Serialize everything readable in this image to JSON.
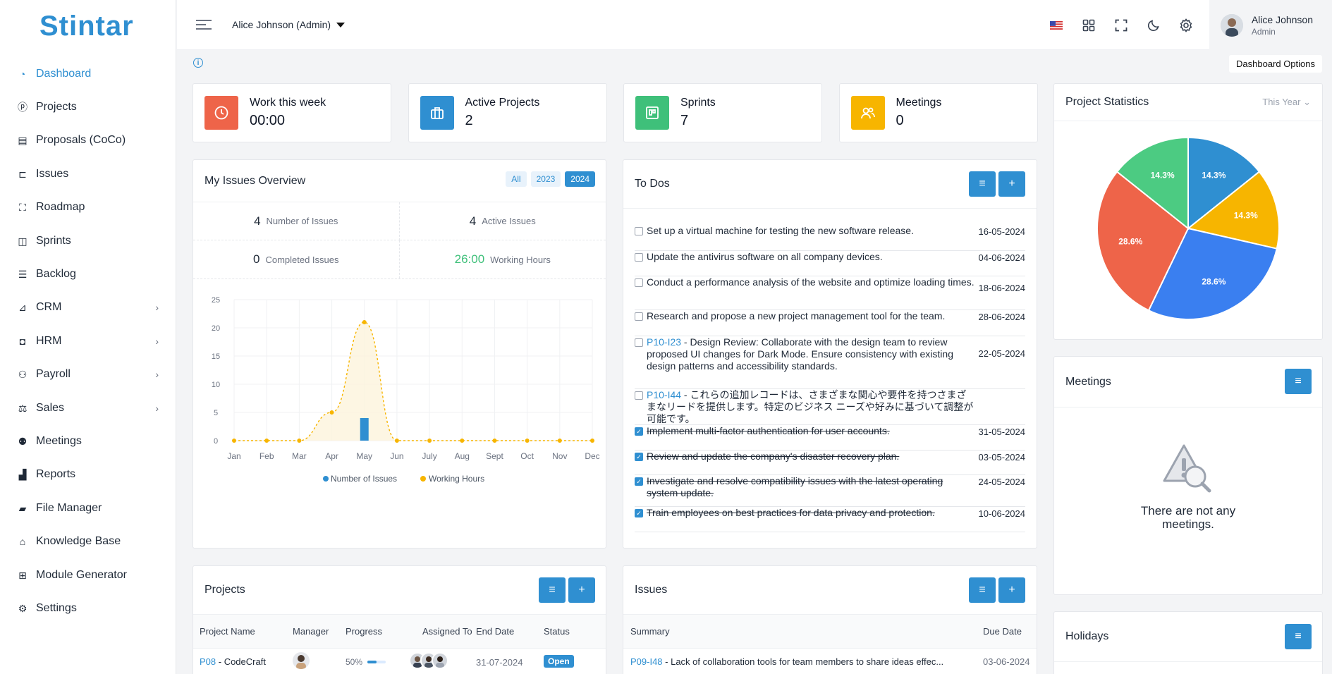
{
  "app": {
    "logo_text": "Stintar"
  },
  "sidebar": {
    "items": [
      {
        "label": "Dashboard",
        "icon": "dashboard-icon"
      },
      {
        "label": "Projects",
        "icon": "projects-icon"
      },
      {
        "label": "Proposals (CoCo)",
        "icon": "proposals-icon"
      },
      {
        "label": "Issues",
        "icon": "issues-icon"
      },
      {
        "label": "Roadmap",
        "icon": "roadmap-icon"
      },
      {
        "label": "Sprints",
        "icon": "sprints-icon"
      },
      {
        "label": "Backlog",
        "icon": "backlog-icon"
      },
      {
        "label": "CRM",
        "icon": "crm-icon"
      },
      {
        "label": "HRM",
        "icon": "hrm-icon"
      },
      {
        "label": "Payroll",
        "icon": "payroll-icon"
      },
      {
        "label": "Sales",
        "icon": "sales-icon"
      },
      {
        "label": "Meetings",
        "icon": "meetings-icon"
      },
      {
        "label": "Reports",
        "icon": "reports-icon"
      },
      {
        "label": "File Manager",
        "icon": "folder-icon"
      },
      {
        "label": "Knowledge Base",
        "icon": "graduation-cap-icon"
      },
      {
        "label": "Module Generator",
        "icon": "grid-icon"
      },
      {
        "label": "Settings",
        "icon": "gear-icon"
      }
    ]
  },
  "header": {
    "role_switch": "Alice Johnson (Admin)",
    "user_name": "Alice Johnson",
    "user_role": "Admin",
    "dashboard_options": "Dashboard Options"
  },
  "stats": [
    {
      "label": "Work this week",
      "value": "00:00",
      "color": "#ee6449"
    },
    {
      "label": "Active Projects",
      "value": "2",
      "color": "#2f8fd1"
    },
    {
      "label": "Sprints",
      "value": "7",
      "color": "#3fc07a"
    },
    {
      "label": "Meetings",
      "value": "0",
      "color": "#f7b500"
    }
  ],
  "issues_overview": {
    "title": "My Issues Overview",
    "year_buttons": [
      "All",
      "2023",
      "2024"
    ],
    "selected_year": "2024",
    "number_of_issues": {
      "value": "4",
      "label": "Number of Issues"
    },
    "active_issues": {
      "value": "4",
      "label": "Active Issues"
    },
    "completed_issues": {
      "value": "0",
      "label": "Completed Issues"
    },
    "working_hours": {
      "value": "26:00",
      "label": "Working Hours"
    }
  },
  "chart_data": [
    {
      "type": "bar",
      "title": "",
      "categories": [
        "Jan",
        "Feb",
        "Mar",
        "Apr",
        "May",
        "Jun",
        "July",
        "Aug",
        "Sept",
        "Oct",
        "Nov",
        "Dec"
      ],
      "ylim": [
        0,
        25
      ],
      "yticks": [
        0,
        5,
        10,
        15,
        20,
        25
      ],
      "legend": "bottom",
      "series": [
        {
          "name": "Number of Issues",
          "type": "bar",
          "color": "#2f8fd1",
          "values": [
            0,
            0,
            0,
            0,
            4,
            0,
            0,
            0,
            0,
            0,
            0,
            0
          ]
        },
        {
          "name": "Working Hours",
          "type": "area",
          "color": "#f7b500",
          "values": [
            0,
            0,
            0,
            5,
            21,
            0,
            0,
            0,
            0,
            0,
            0,
            0
          ]
        }
      ]
    },
    {
      "type": "pie",
      "title": "Project Statistics",
      "filter": "This Year",
      "slices": [
        {
          "label": "14.3%",
          "value": 14.3,
          "color": "#2f8fd1"
        },
        {
          "label": "14.3%",
          "value": 14.3,
          "color": "#f7b500"
        },
        {
          "label": "28.6%",
          "value": 28.6,
          "color": "#3a7ff0"
        },
        {
          "label": "28.6%",
          "value": 28.6,
          "color": "#ee6449"
        },
        {
          "label": "14.3%",
          "value": 14.3,
          "color": "#4ccb82"
        }
      ]
    }
  ],
  "todos": {
    "title": "To Dos",
    "items": [
      {
        "id": "",
        "text": "Set up a virtual machine for testing the new software release.",
        "date": "16-05-2024",
        "done": false
      },
      {
        "id": "",
        "text": "Update the antivirus software on all company devices.",
        "date": "04-06-2024",
        "done": false
      },
      {
        "id": "",
        "text": "Conduct a performance analysis of the website and optimize loading times.",
        "date": "18-06-2024",
        "done": false
      },
      {
        "id": "",
        "text": "Research and propose a new project management tool for the team.",
        "date": "28-06-2024",
        "done": false
      },
      {
        "id": "P10-I23",
        "text": " - Design Review: Collaborate with the design team to review proposed UI changes for Dark Mode. Ensure consistency with existing design patterns and accessibility standards.",
        "date": "22-05-2024",
        "done": false
      },
      {
        "id": "P10-I44",
        "text": " - これらの追加レコードは、さまざまな関心や要件を持つさまざまなリードを提供します。特定のビジネス ニーズや好みに基づいて調整が可能です。",
        "date": "",
        "done": false
      },
      {
        "id": "",
        "text": "Implement multi-factor authentication for user accounts.",
        "date": "31-05-2024",
        "done": true
      },
      {
        "id": "",
        "text": "Review and update the company's disaster recovery plan.",
        "date": "03-05-2024",
        "done": true
      },
      {
        "id": "",
        "text": "Investigate and resolve compatibility issues with the latest operating system update.",
        "date": "24-05-2024",
        "done": true
      },
      {
        "id": "",
        "text": "Train employees on best practices for data privacy and protection.",
        "date": "10-06-2024",
        "done": true
      }
    ]
  },
  "meetings": {
    "title": "Meetings",
    "empty": "There are not any meetings."
  },
  "holidays": {
    "title": "Holidays"
  },
  "projects": {
    "title": "Projects",
    "columns": [
      "Project Name",
      "Manager",
      "Progress",
      "Assigned To",
      "End Date",
      "Status"
    ],
    "rows": [
      {
        "code": "P08",
        "name": " - CodeCraft",
        "progress_text": "50%",
        "progress": 0.5,
        "end_date": "31-07-2024",
        "status": "Open"
      }
    ]
  },
  "issues": {
    "title": "Issues",
    "columns": [
      "Summary",
      "Due Date"
    ],
    "rows": [
      {
        "code": "P09-I48",
        "summary": " - Lack of collaboration tools for team members to share ideas effec...",
        "due": "03-06-2024"
      }
    ]
  }
}
